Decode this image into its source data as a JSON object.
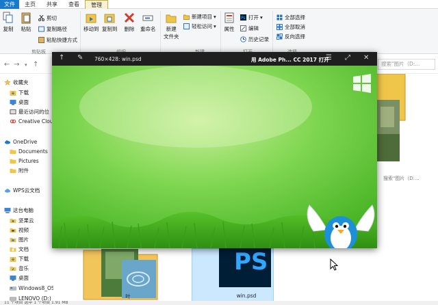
{
  "ribbon_tabs": [
    "文件",
    "主页",
    "共享",
    "查看",
    "管理"
  ],
  "clipboard": {
    "copy": "复制",
    "paste": "粘贴",
    "cut": "剪切",
    "copy_path": "复制路径",
    "paste_shortcut": "粘贴快捷方式",
    "group": "剪贴板"
  },
  "organize": {
    "move_to": "移动到",
    "copy_to": "复制到",
    "delete": "删除",
    "rename": "重命名",
    "group": "组织"
  },
  "new_group": {
    "new_folder": "新建\n文件夹",
    "new_item": "新建项目",
    "easy_access": "轻松访问",
    "group": "新建"
  },
  "open_group": {
    "properties": "属性",
    "open": "打开",
    "edit": "编辑",
    "history": "历史记录",
    "group": "打开"
  },
  "select_group": {
    "select_all": "全部选择",
    "select_none": "全部取消",
    "invert": "反向选择",
    "group": "选择"
  },
  "search_placeholder": "搜索\"图片（D:...",
  "nav_items": [
    {
      "label": "收藏夹",
      "icon": "star-icon"
    },
    {
      "label": "下载",
      "icon": "download-folder-icon"
    },
    {
      "label": "桌面",
      "icon": "desktop-icon"
    },
    {
      "label": "最近访问的位",
      "icon": "recent-icon"
    },
    {
      "label": "Creative Clou",
      "icon": "creative-cloud-icon"
    },
    {
      "label": "OneDrive",
      "icon": "onedrive-icon"
    },
    {
      "label": "Documents",
      "icon": "folder-icon"
    },
    {
      "label": "Pictures",
      "icon": "folder-icon"
    },
    {
      "label": "附件",
      "icon": "folder-icon"
    },
    {
      "label": "WPS云文档",
      "icon": "wps-cloud-icon"
    },
    {
      "label": "这台电脑",
      "icon": "computer-icon"
    },
    {
      "label": "坚果云",
      "icon": "nutstore-icon"
    },
    {
      "label": "视频",
      "icon": "video-folder-icon"
    },
    {
      "label": "图片",
      "icon": "pictures-folder-icon"
    },
    {
      "label": "文档",
      "icon": "documents-folder-icon"
    },
    {
      "label": "下载",
      "icon": "download-folder-icon"
    },
    {
      "label": "音乐",
      "icon": "music-folder-icon"
    },
    {
      "label": "桌面",
      "icon": "desktop-icon"
    },
    {
      "label": "Windows8_OS",
      "icon": "drive-icon"
    },
    {
      "label": "LENOVO (D:)",
      "icon": "drive-icon"
    }
  ],
  "files": {
    "folder_label": "叶",
    "psd_label": "win.psd"
  },
  "status_text": "11 个项目    选中 1 个项目 1.91 MB",
  "viewer": {
    "title": "760×428: win.psd",
    "open_with": "用 Adobe Ph... CC 2017 打开"
  },
  "colors": {
    "accent": "#1979ca",
    "psd_blue": "#31a8ff",
    "psd_bg": "#001e36",
    "grass_green": "#3fae1e"
  }
}
